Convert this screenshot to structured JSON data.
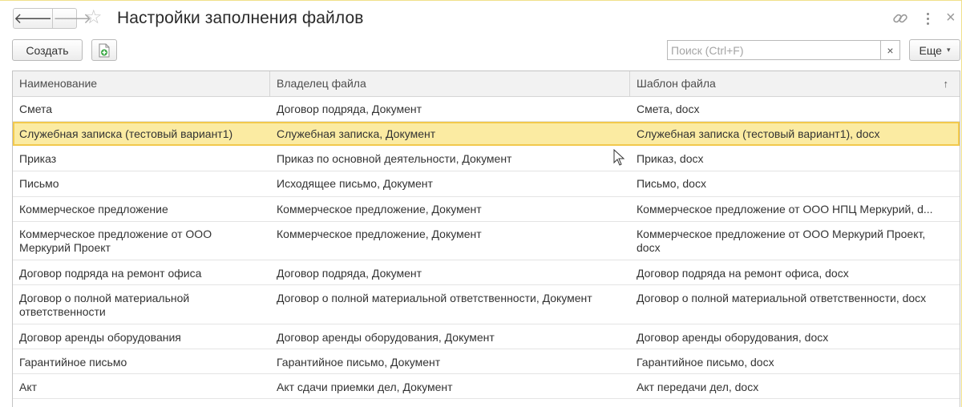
{
  "window": {
    "title": "Настройки заполнения файлов",
    "icons": {
      "back": "arrow-left-icon",
      "forward": "arrow-right-icon",
      "favorite": "star-icon",
      "link": "link-icon",
      "more": "more-vertical-icon",
      "close": "close-icon"
    }
  },
  "toolbar": {
    "create_label": "Создать",
    "search_placeholder": "Поиск (Ctrl+F)",
    "search_value": "",
    "clear_label": "×",
    "more_label": "Еще",
    "more_caret": "▾"
  },
  "table": {
    "columns": [
      "Наименование",
      "Владелец файла",
      "Шаблон файла"
    ],
    "sort_indicator": "↑",
    "selected_index": 1,
    "rows": [
      [
        "Смета",
        "Договор подряда, Документ",
        "Смета, docx"
      ],
      [
        "Служебная записка (тестовый вариант1)",
        "Служебная записка, Документ",
        "Служебная записка (тестовый вариант1), docx"
      ],
      [
        "Приказ",
        "Приказ по основной деятельности, Документ",
        "Приказ, docx"
      ],
      [
        "Письмо",
        "Исходящее письмо, Документ",
        "Письмо, docx"
      ],
      [
        "Коммерческое предложение",
        "Коммерческое предложение, Документ",
        "Коммерческое предложение от ООО НПЦ Меркурий, d..."
      ],
      [
        "Коммерческое предложение от ООО Меркурий Проект",
        "Коммерческое предложение, Документ",
        "Коммерческое предложение от ООО Меркурий Проект, docx"
      ],
      [
        "Договор подряда на ремонт офиса",
        "Договор подряда, Документ",
        "Договор подряда на ремонт офиса, docx"
      ],
      [
        "Договор о полной материальной ответственности",
        "Договор о полной материальной ответственности, Документ",
        "Договор о полной материальной ответственности, docx"
      ],
      [
        "Договор аренды оборудования",
        "Договор аренды оборудования, Документ",
        "Договор аренды оборудования, docx"
      ],
      [
        "Гарантийное письмо",
        "Гарантийное письмо, Документ",
        "Гарантийное письмо, docx"
      ],
      [
        "Акт",
        "Акт сдачи приемки дел, Документ",
        "Акт передачи дел, docx"
      ]
    ]
  },
  "colors": {
    "selected_row": "#fbeba2",
    "selected_border": "#f2c94c",
    "header_bg": "#f2f2f2",
    "doc_icon_green": "#3aa845"
  }
}
